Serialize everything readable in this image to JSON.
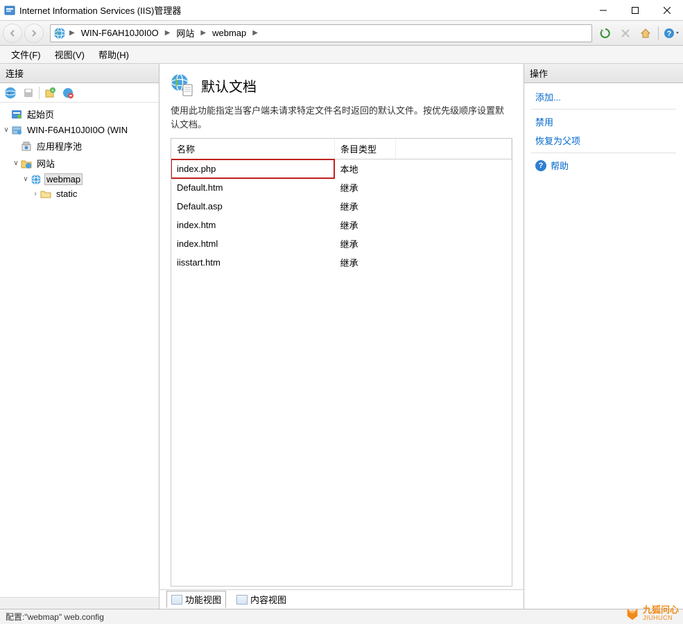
{
  "window": {
    "title": "Internet Information Services (IIS)管理器"
  },
  "breadcrumb": {
    "segments": [
      "WIN-F6AH10J0I0O",
      "网站",
      "webmap"
    ]
  },
  "menubar": {
    "file": "文件(F)",
    "view": "视图(V)",
    "help": "帮助(H)"
  },
  "connections": {
    "title": "连接",
    "tree": {
      "start": "起始页",
      "server": "WIN-F6AH10J0I0O (WIN",
      "apppools": "应用程序池",
      "sites": "网站",
      "site_webmap": "webmap",
      "static": "static"
    }
  },
  "feature": {
    "title": "默认文档",
    "description": "使用此功能指定当客户端未请求特定文件名时返回的默认文件。按优先级顺序设置默认文档。",
    "columns": {
      "name": "名称",
      "entry_type": "条目类型"
    },
    "rows": [
      {
        "name": "index.php",
        "type": "本地",
        "highlight": true
      },
      {
        "name": "Default.htm",
        "type": "继承"
      },
      {
        "name": "Default.asp",
        "type": "继承"
      },
      {
        "name": "index.htm",
        "type": "继承"
      },
      {
        "name": "index.html",
        "type": "继承"
      },
      {
        "name": "iisstart.htm",
        "type": "继承"
      }
    ],
    "tabs": {
      "features_view": "功能视图",
      "content_view": "内容视图"
    }
  },
  "actions": {
    "title": "操作",
    "add": "添加...",
    "disable": "禁用",
    "revert": "恢复为父项",
    "help": "帮助"
  },
  "statusbar": {
    "text": "配置:\"webmap\" web.config"
  },
  "watermark": {
    "name": "九狐问心",
    "sub": "JIUHUCN"
  }
}
